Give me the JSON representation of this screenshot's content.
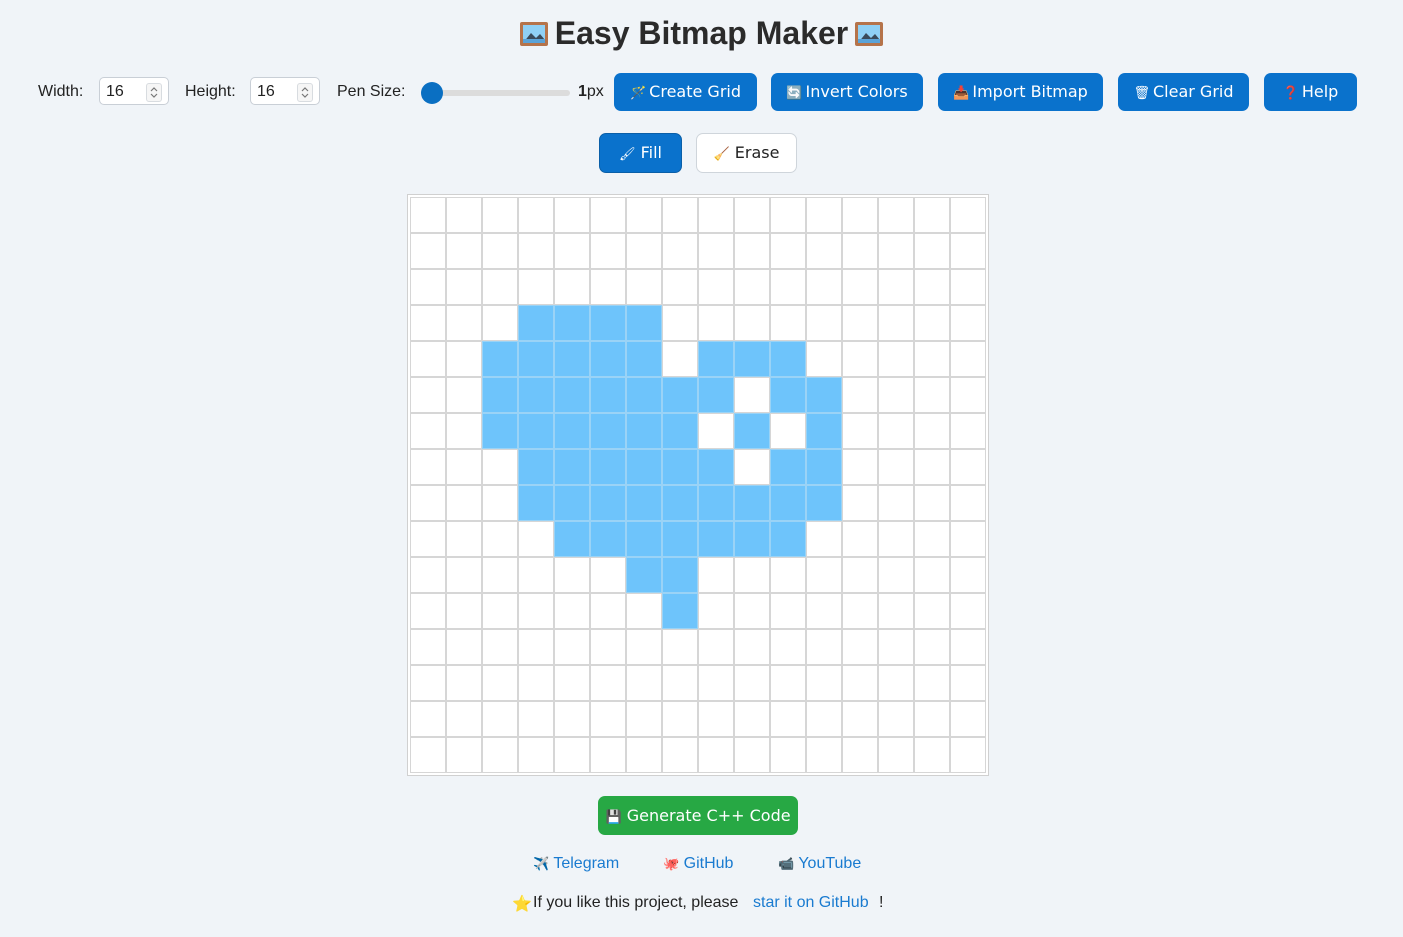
{
  "title": "Easy Bitmap Maker",
  "toolbar": {
    "width_label": "Width:",
    "width_value": "16",
    "height_label": "Height:",
    "height_value": "16",
    "pen_label": "Pen Size:",
    "pen_value": "1",
    "pen_unit": "px",
    "create_grid": "Create Grid",
    "invert_colors": "Invert Colors",
    "import_bitmap": "Import Bitmap",
    "clear_grid": "Clear Grid",
    "help": "Help"
  },
  "modes": {
    "fill": "Fill",
    "erase": "Erase",
    "active": "fill"
  },
  "grid": {
    "cols": 16,
    "rows": 16,
    "fill_color": "#6ec4fb",
    "rows_data": [
      "0000000000000000",
      "0000000000000000",
      "0000000000000000",
      "0001111000000000",
      "0011111011100000",
      "0011111110110000",
      "0011111101010000",
      "0001111110110000",
      "0001111111110000",
      "0000111111100000",
      "0000001100000000",
      "0000000100000000",
      "0000000000000000",
      "0000000000000000",
      "0000000000000000",
      "0000000000000000"
    ]
  },
  "generate_label": "Generate C++ Code",
  "links": {
    "telegram": "Telegram",
    "github": "GitHub",
    "youtube": "YouTube"
  },
  "footer": {
    "prefix": "If you like this project, please",
    "link": "star it on GitHub",
    "suffix": "!"
  },
  "colors": {
    "primary": "#0a72cc",
    "success": "#27a844",
    "link": "#1a7bd0",
    "background": "#f0f4f8"
  }
}
